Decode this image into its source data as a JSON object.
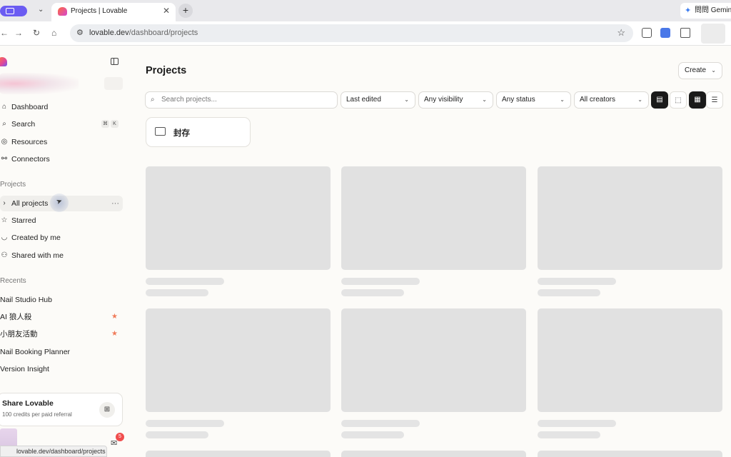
{
  "browser": {
    "tab_title": "Projects | Lovable",
    "tab_close": "✕",
    "new_tab": "+",
    "gemini_label": "問問 Gemini",
    "url_domain": "lovable.dev",
    "url_path": "/dashboard/projects",
    "status_url": "lovable.dev/dashboard/projects"
  },
  "sidebar": {
    "nav": [
      {
        "label": "Dashboard",
        "icon": "home-icon"
      },
      {
        "label": "Search",
        "icon": "search-icon",
        "shortcut": [
          "⌘",
          "K"
        ]
      },
      {
        "label": "Resources",
        "icon": "compass-icon"
      },
      {
        "label": "Connectors",
        "icon": "connectors-icon"
      }
    ],
    "projects_label": "Projects",
    "projects": [
      {
        "label": "All projects",
        "icon": "chevron-right-icon"
      },
      {
        "label": "Starred",
        "icon": "star-icon"
      },
      {
        "label": "Created by me",
        "icon": "user-icon"
      },
      {
        "label": "Shared with me",
        "icon": "users-icon"
      }
    ],
    "more": "···",
    "recents_label": "Recents",
    "recents": [
      {
        "label": "Nail Studio Hub",
        "starred": false
      },
      {
        "label": "AI 狼人殺",
        "starred": true
      },
      {
        "label": "小朋友活動",
        "starred": true
      },
      {
        "label": "Nail Booking Planner",
        "starred": false
      },
      {
        "label": "Version Insight",
        "starred": false
      }
    ],
    "share": {
      "title": "Share Lovable",
      "subtitle": "100 credits per paid referral"
    },
    "inbox_badge": "5"
  },
  "main": {
    "title": "Projects",
    "create_label": "Create",
    "search_placeholder": "Search projects...",
    "filters": [
      "Last edited",
      "Any visibility",
      "Any status",
      "All creators"
    ],
    "folder_label": "封存"
  }
}
